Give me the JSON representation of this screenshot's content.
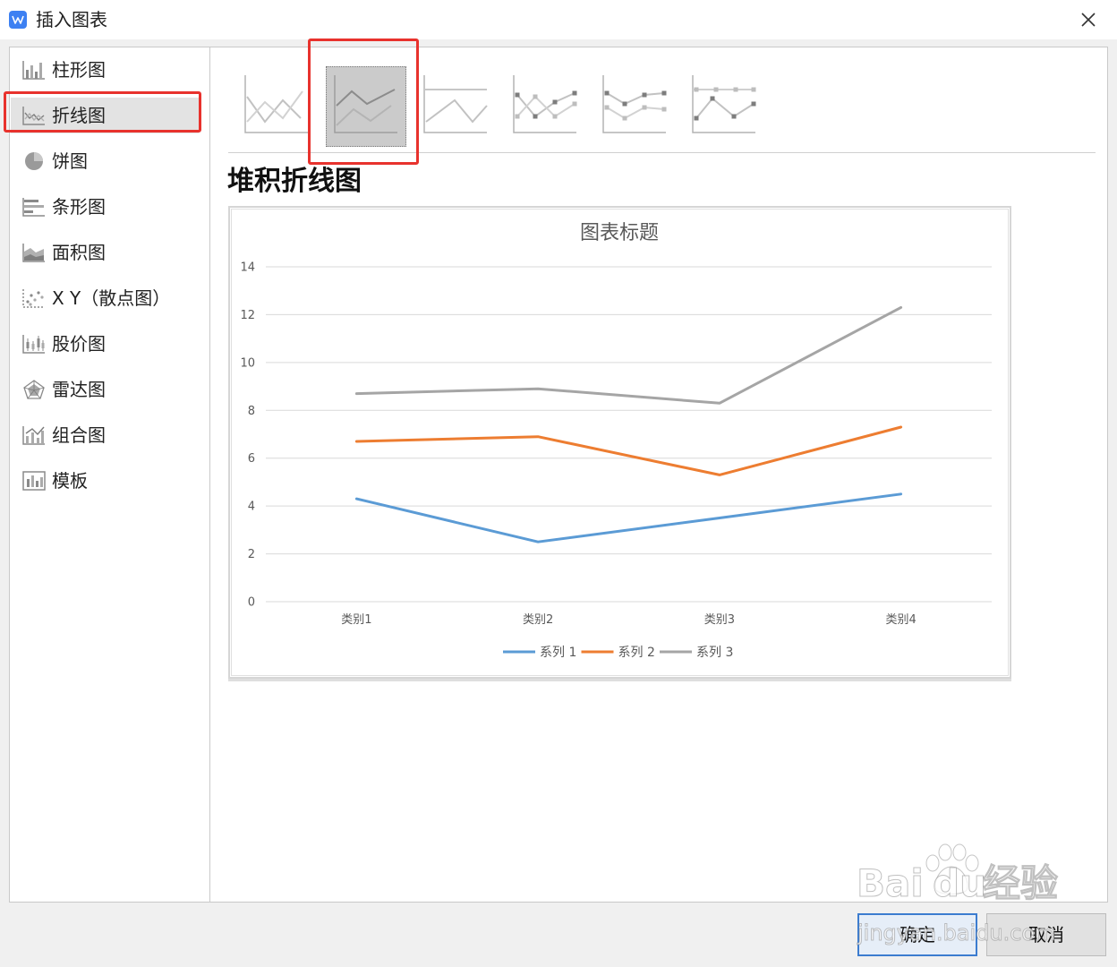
{
  "window": {
    "title": "插入图表",
    "app_icon": "wps-app-icon",
    "close_icon": "close-icon"
  },
  "sidebar": {
    "items": [
      {
        "label": "柱形图",
        "icon": "column-chart-icon"
      },
      {
        "label": "折线图",
        "icon": "line-chart-icon",
        "selected": true
      },
      {
        "label": "饼图",
        "icon": "pie-chart-icon"
      },
      {
        "label": "条形图",
        "icon": "bar-chart-icon"
      },
      {
        "label": "面积图",
        "icon": "area-chart-icon"
      },
      {
        "label": "X Y（散点图）",
        "icon": "scatter-chart-icon"
      },
      {
        "label": "股价图",
        "icon": "stock-chart-icon"
      },
      {
        "label": "雷达图",
        "icon": "radar-chart-icon"
      },
      {
        "label": "组合图",
        "icon": "combo-chart-icon"
      },
      {
        "label": "模板",
        "icon": "template-icon"
      }
    ]
  },
  "subtypes": {
    "items": [
      {
        "icon": "line-subtype-icon"
      },
      {
        "icon": "stacked-line-subtype-icon",
        "selected": true
      },
      {
        "icon": "percent-stacked-line-subtype-icon"
      },
      {
        "icon": "line-with-markers-subtype-icon"
      },
      {
        "icon": "stacked-line-with-markers-subtype-icon"
      },
      {
        "icon": "percent-stacked-line-with-markers-subtype-icon"
      }
    ],
    "selected_title": "堆积折线图"
  },
  "chart_data": {
    "type": "line",
    "stacked": true,
    "title": "图表标题",
    "categories": [
      "类别1",
      "类别2",
      "类别3",
      "类别4"
    ],
    "series": [
      {
        "name": "系列 1",
        "values": [
          4.3,
          2.5,
          3.5,
          4.5
        ],
        "color": "#5B9BD5"
      },
      {
        "name": "系列 2",
        "values": [
          2.4,
          4.4,
          1.8,
          2.8
        ],
        "color": "#ED7D31"
      },
      {
        "name": "系列 3",
        "values": [
          2,
          2,
          3,
          5
        ],
        "color": "#A5A5A5"
      }
    ],
    "ylim": [
      0,
      14
    ],
    "yticks": [
      0,
      2,
      4,
      6,
      8,
      10,
      12,
      14
    ],
    "grid": true,
    "legend": "bottom"
  },
  "buttons": {
    "ok": "确定",
    "cancel": "取消"
  },
  "watermark": {
    "part_a": "Bai",
    "part_b": "du",
    "part_c": "经验",
    "url": "jingyan.baidu.com"
  },
  "colors": {
    "accent": "#3c7ccf",
    "annotation": "#e8322d",
    "selected_bg": "#e3e3e3"
  }
}
